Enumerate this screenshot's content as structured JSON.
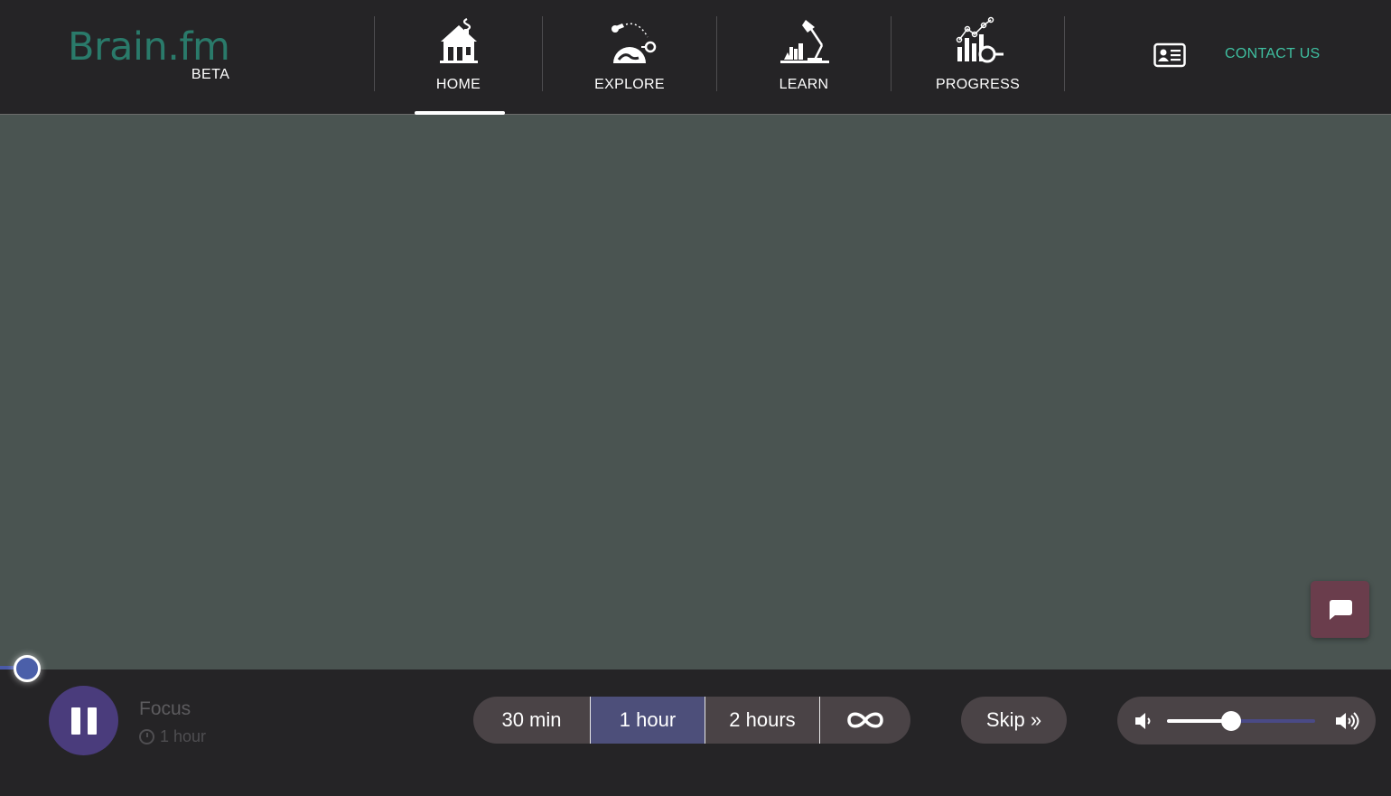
{
  "brand": {
    "name": "Brain.fm",
    "badge": "BETA",
    "color": "#2a7a6a"
  },
  "nav": {
    "items": [
      {
        "label": "HOME",
        "icon": "house-icon",
        "active": true
      },
      {
        "label": "EXPLORE",
        "icon": "rocket-globe-icon",
        "active": false
      },
      {
        "label": "LEARN",
        "icon": "desk-lamp-icon",
        "active": false
      },
      {
        "label": "PROGRESS",
        "icon": "chart-magnifier-icon",
        "active": false
      }
    ],
    "contact": {
      "label": "CONTACT US",
      "icon": "id-card-icon",
      "color": "#3fbfa0"
    }
  },
  "player": {
    "state": "playing",
    "track_title": "Focus",
    "track_duration": "1 hour",
    "progress": 0.01,
    "timer_options": [
      {
        "label": "30 min",
        "active": false
      },
      {
        "label": "1 hour",
        "active": true
      },
      {
        "label": "",
        "icon": "infinity-icon",
        "active": false
      }
    ],
    "timer_two_hours": "2 hours",
    "skip_label": "Skip »",
    "volume": 0.43,
    "accent": "#4a3c7c"
  },
  "chat": {
    "icon": "chat-bubble-icon",
    "color": "#6a3d4c"
  }
}
